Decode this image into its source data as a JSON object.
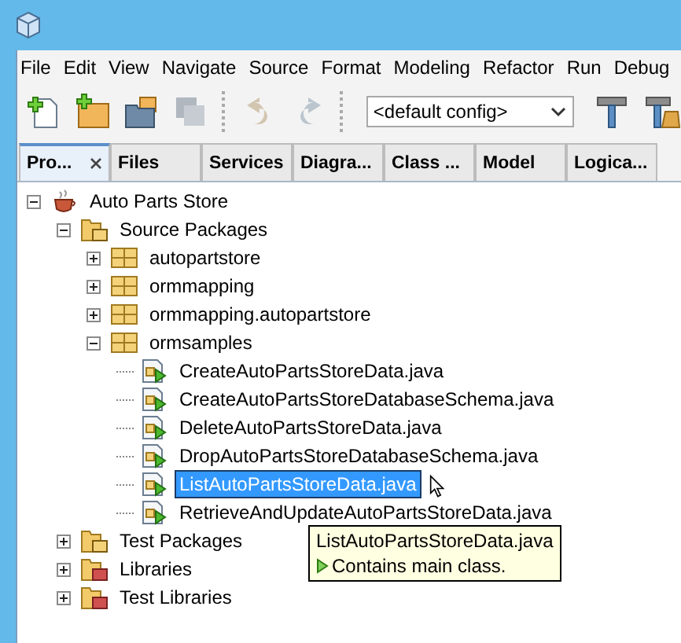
{
  "menu": [
    "File",
    "Edit",
    "View",
    "Navigate",
    "Source",
    "Format",
    "Modeling",
    "Refactor",
    "Run",
    "Debug"
  ],
  "toolbar": [
    {
      "kind": "new-file"
    },
    {
      "kind": "new-project"
    },
    {
      "kind": "open-project"
    },
    {
      "kind": "save-all",
      "disabled": true
    },
    {
      "kind": "separator"
    },
    {
      "kind": "undo",
      "disabled": true
    },
    {
      "kind": "redo",
      "disabled": true
    },
    {
      "kind": "separator"
    },
    {
      "kind": "config",
      "value": "<default config>"
    },
    {
      "kind": "build"
    },
    {
      "kind": "clean-build"
    }
  ],
  "tabs": [
    {
      "label": "Pro...",
      "selected": true,
      "closable": true
    },
    {
      "label": "Files",
      "selected": false
    },
    {
      "label": "Services",
      "selected": false
    },
    {
      "label": "Diagra...",
      "selected": false
    },
    {
      "label": "Class ...",
      "selected": false
    },
    {
      "label": "Model",
      "selected": false
    },
    {
      "label": "Logica...",
      "selected": false
    }
  ],
  "tree": [
    {
      "label": "Auto Parts Store",
      "kind": "project",
      "expanded": true,
      "selected": false,
      "children": [
        {
          "label": "Source Packages",
          "kind": "source-folder",
          "expanded": true,
          "selected": false,
          "children": [
            {
              "label": "autopartstore",
              "kind": "package",
              "expanded": false,
              "selected": false
            },
            {
              "label": "ormmapping",
              "kind": "package",
              "expanded": false,
              "selected": false
            },
            {
              "label": "ormmapping.autopartstore",
              "kind": "package",
              "expanded": false,
              "selected": false
            },
            {
              "label": "ormsamples",
              "kind": "package",
              "expanded": true,
              "selected": false,
              "children": [
                {
                  "label": "CreateAutoPartsStoreData.java",
                  "kind": "java-file",
                  "selected": false
                },
                {
                  "label": "CreateAutoPartsStoreDatabaseSchema.java",
                  "kind": "java-file",
                  "selected": false
                },
                {
                  "label": "DeleteAutoPartsStoreData.java",
                  "kind": "java-file",
                  "selected": false
                },
                {
                  "label": "DropAutoPartsStoreDatabaseSchema.java",
                  "kind": "java-file",
                  "selected": false
                },
                {
                  "label": "ListAutoPartsStoreData.java",
                  "kind": "java-file",
                  "selected": true
                },
                {
                  "label": "RetrieveAndUpdateAutoPartsStoreData.java",
                  "kind": "java-file",
                  "selected": false
                }
              ]
            }
          ]
        },
        {
          "label": "Test Packages",
          "kind": "test-folder",
          "expanded": false,
          "selected": false
        },
        {
          "label": "Libraries",
          "kind": "library-folder",
          "expanded": false,
          "selected": false
        },
        {
          "label": "Test Libraries",
          "kind": "library-folder",
          "expanded": false,
          "selected": false
        }
      ]
    }
  ],
  "tooltip": {
    "title": "ListAutoPartsStoreData.java",
    "line": "Contains main class."
  }
}
